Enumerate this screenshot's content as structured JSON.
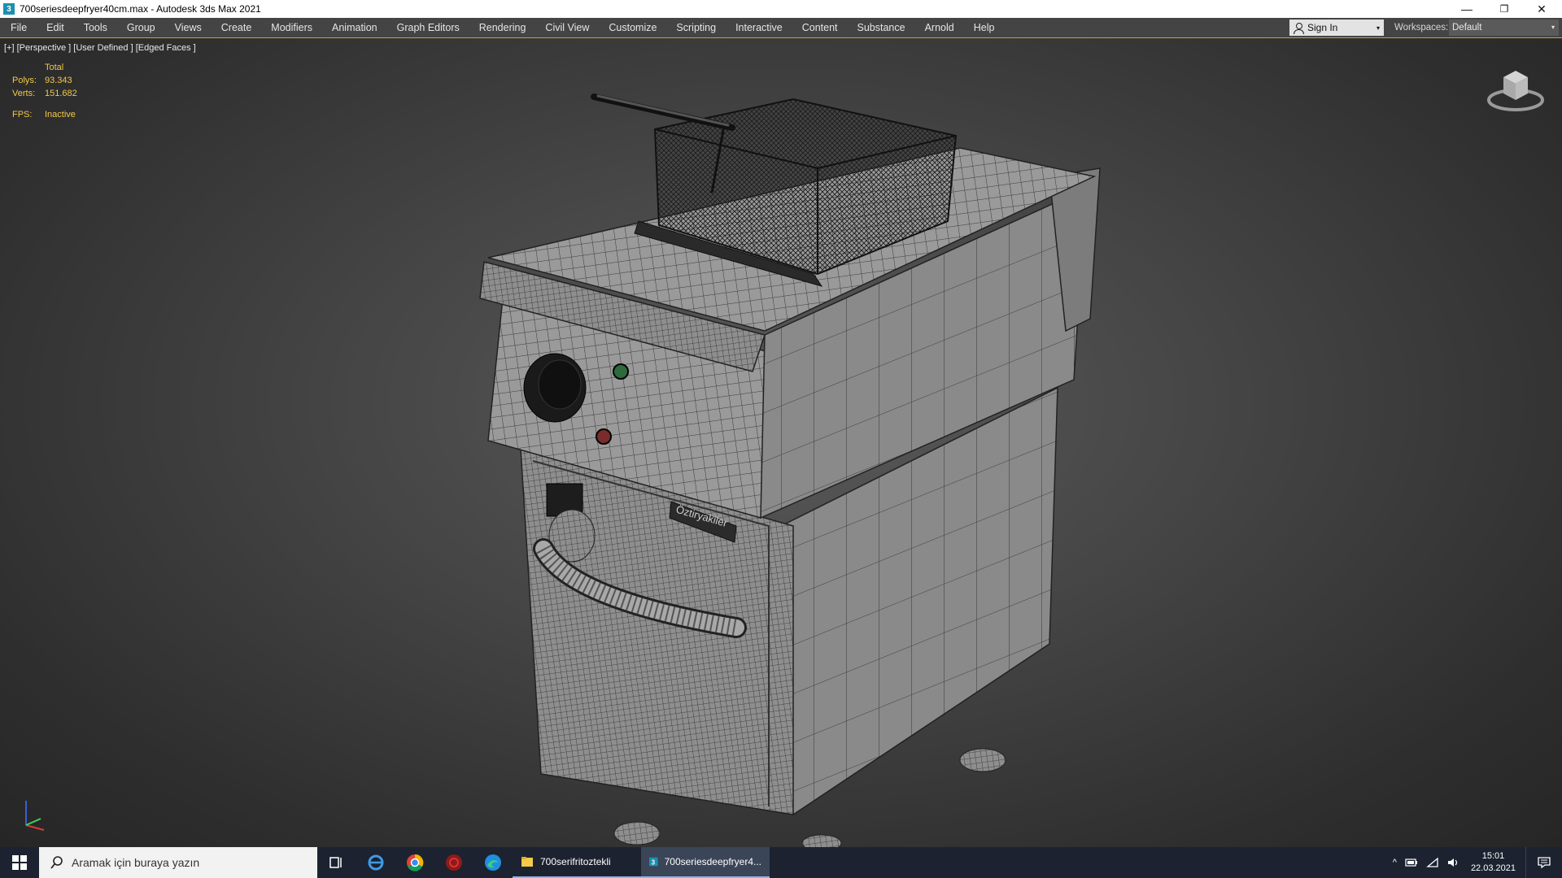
{
  "window": {
    "title": "700seriesdeepfryer40cm.max - Autodesk 3ds Max 2021",
    "app_icon_glyph": "3",
    "minimize_glyph": "—",
    "restore_glyph": "❐",
    "close_glyph": "✕"
  },
  "menu": {
    "items": [
      "File",
      "Edit",
      "Tools",
      "Group",
      "Views",
      "Create",
      "Modifiers",
      "Animation",
      "Graph Editors",
      "Rendering",
      "Civil View",
      "Customize",
      "Scripting",
      "Interactive",
      "Content",
      "Substance",
      "Arnold",
      "Help"
    ]
  },
  "account": {
    "sign_in_label": "Sign In",
    "dropdown_glyph": "▾"
  },
  "workspaces": {
    "label": "Workspaces:",
    "value": "Default",
    "dropdown_glyph": "▾"
  },
  "viewport": {
    "label": "[+] [Perspective ] [User Defined ] [Edged Faces ]",
    "stats": {
      "header": "Total",
      "polys_label": "Polys:",
      "polys_value": "93.343",
      "verts_label": "Verts:",
      "verts_value": "151.682",
      "fps_label": "FPS:",
      "fps_value": "Inactive"
    },
    "model_brand_text": "Öztiryakiler"
  },
  "taskbar": {
    "search_placeholder": "Aramak için buraya yazın",
    "apps": [
      {
        "label": "700serifritoztekli",
        "icon": "folder-icon"
      },
      {
        "label": "700seriesdeepfryer4...",
        "icon": "3dsmax-icon"
      }
    ],
    "tray_up_glyph": "^",
    "time": "15:01",
    "date": "22.03.2021"
  },
  "colors": {
    "menubar_bg": "#444444",
    "accent_line": "#c9a13a",
    "stats_text": "#f2c84a",
    "taskbar_bg": "#1c2230"
  }
}
